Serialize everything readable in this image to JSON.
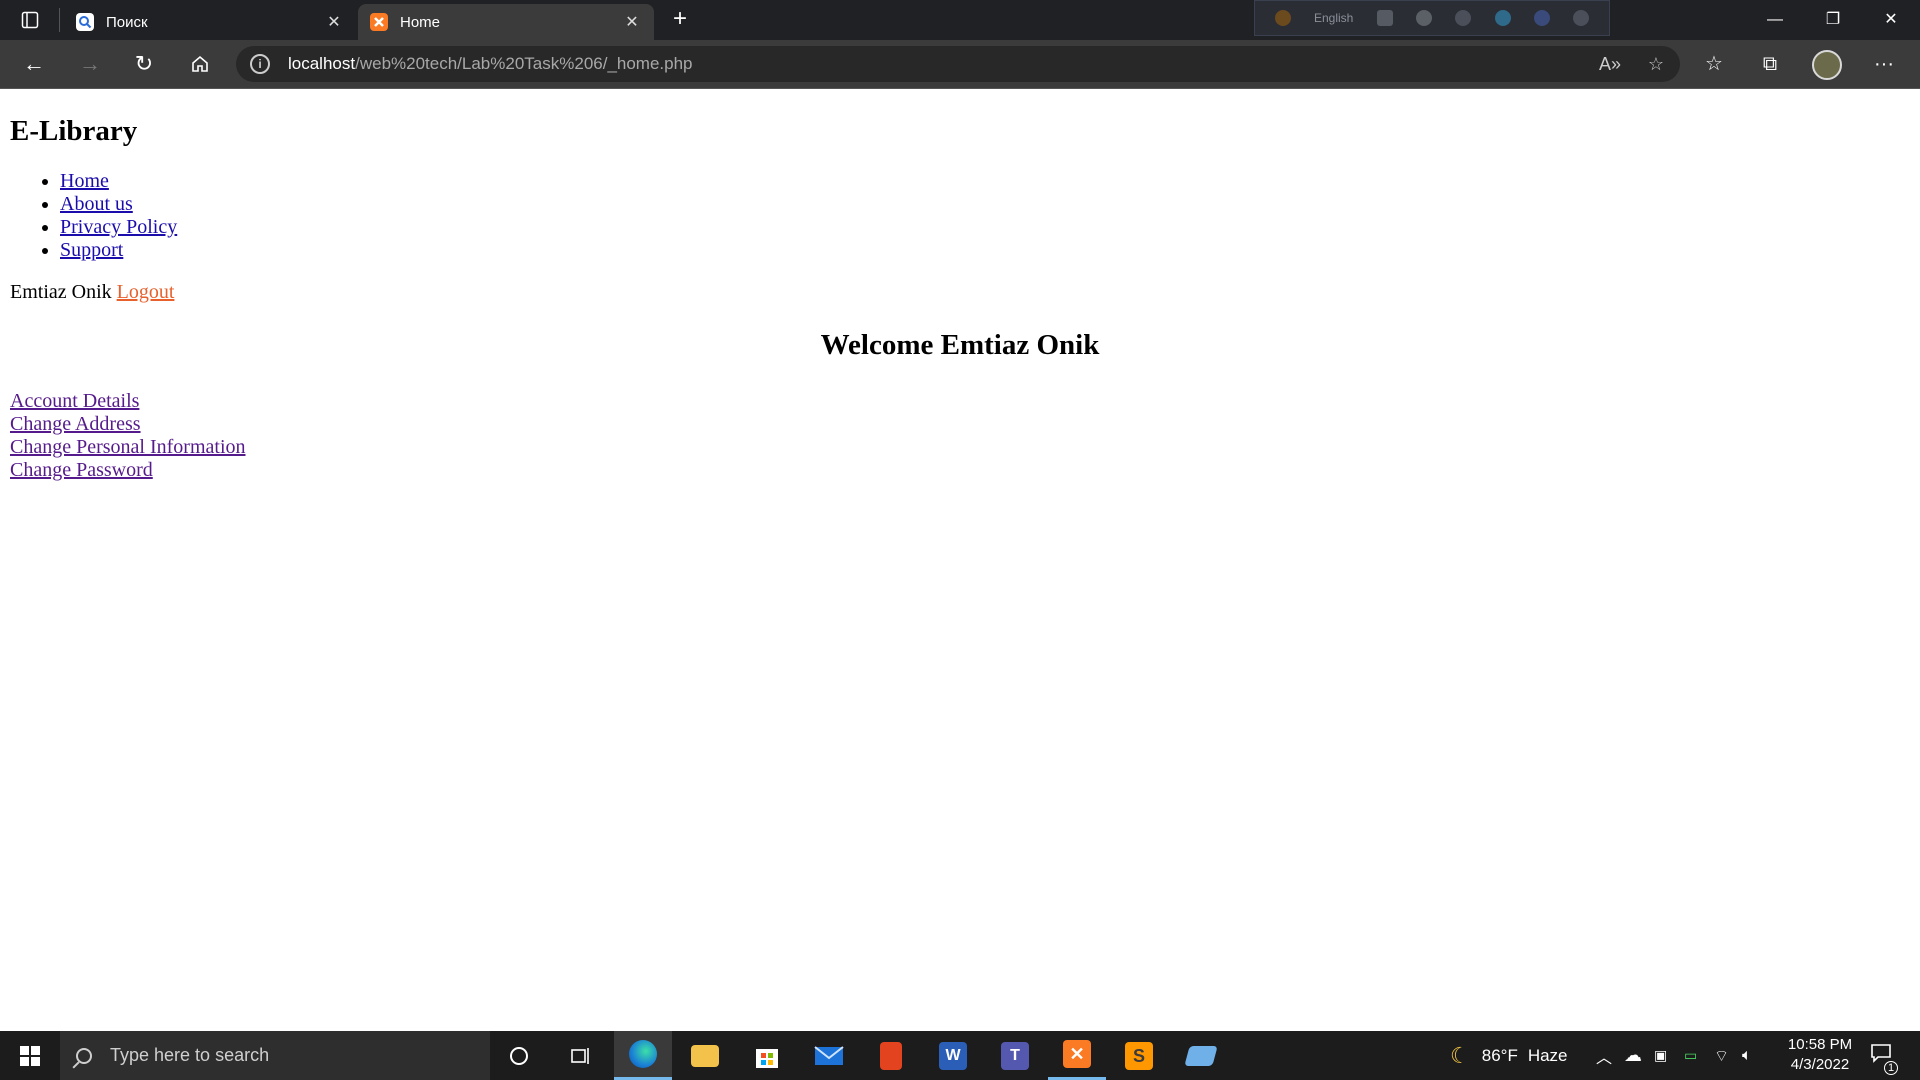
{
  "browser": {
    "tabs": [
      {
        "label": "Поиск",
        "icon": "search-favicon",
        "active": false
      },
      {
        "label": "Home",
        "icon": "xampp-favicon",
        "active": true
      }
    ],
    "extension_bar": {
      "language": "English"
    },
    "url_host": "localhost",
    "url_path": "/web%20tech/Lab%20Task%206/_home.php"
  },
  "page": {
    "site_title": "E-Library",
    "nav": [
      "Home",
      "About us",
      "Privacy Policy",
      "Support"
    ],
    "user_name": "Emtiaz Onik",
    "logout_label": "Logout",
    "welcome": "Welcome Emtiaz Onik",
    "account_links": [
      "Account Details",
      "Change Address",
      "Change Personal Information",
      "Change Password"
    ]
  },
  "taskbar": {
    "search_placeholder": "Type here to search",
    "weather_temp": "86°F",
    "weather_desc": "Haze",
    "time": "10:58 PM",
    "date": "4/3/2022",
    "notification_count": "1",
    "apps": [
      "cortana-icon",
      "task-view-icon",
      "edge-icon",
      "file-explorer-icon",
      "microsoft-store-icon",
      "mail-icon",
      "office-icon",
      "word-icon",
      "teams-icon",
      "xampp-icon",
      "sublime-text-icon",
      "notes-icon"
    ]
  },
  "colors": {
    "link": "#1a0dab",
    "visited_link": "#551a8b",
    "logout_link": "#e8602c",
    "chrome_dark": "#202124",
    "taskbar": "#1c1c1c",
    "taskbar_accent": "#76b9ed"
  }
}
